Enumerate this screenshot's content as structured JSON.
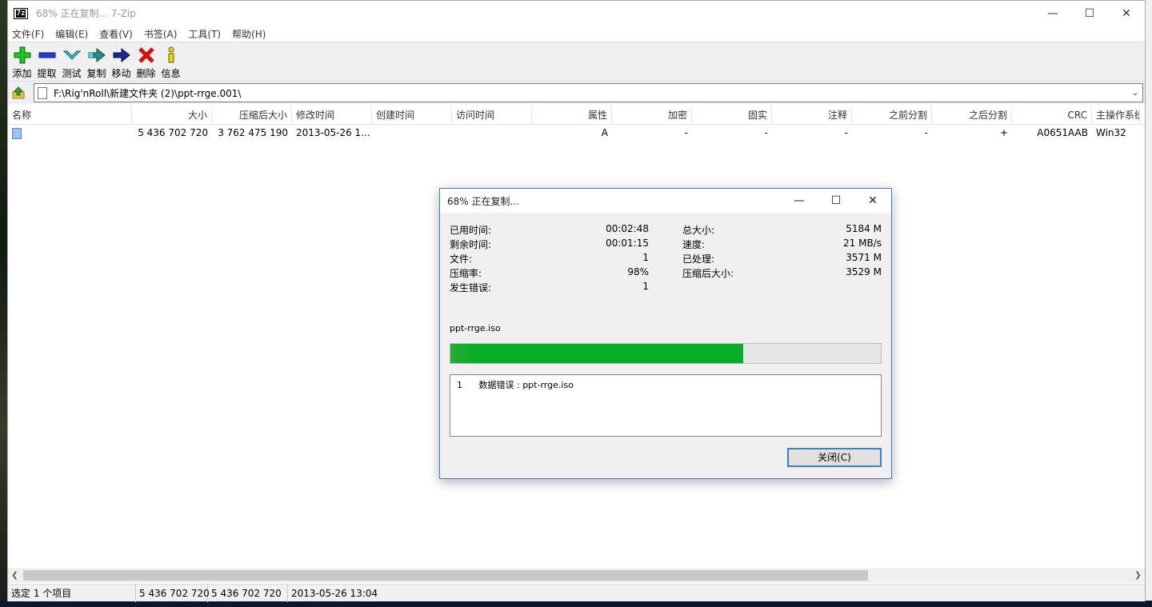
{
  "window": {
    "title": "68% 正在复制... 7-Zip",
    "icon_text": "7z",
    "controls": {
      "minimize": "—",
      "maximize": "☐",
      "close": "✕"
    }
  },
  "menu": [
    "文件(F)",
    "编辑(E)",
    "查看(V)",
    "书签(A)",
    "工具(T)",
    "帮助(H)"
  ],
  "toolbar": [
    {
      "label": "添加",
      "icon": "add-icon"
    },
    {
      "label": "提取",
      "icon": "extract-icon"
    },
    {
      "label": "测试",
      "icon": "test-icon"
    },
    {
      "label": "复制",
      "icon": "copy-icon"
    },
    {
      "label": "移动",
      "icon": "move-icon"
    },
    {
      "label": "删除",
      "icon": "delete-icon"
    },
    {
      "label": "信息",
      "icon": "info-icon"
    }
  ],
  "address": {
    "path": "F:\\Rig'nRoll\\新建文件夹 (2)\\ppt-rrge.001\\"
  },
  "columns": [
    "名称",
    "大小",
    "压缩后大小",
    "修改时间",
    "创建时间",
    "访问时间",
    "属性",
    "加密",
    "固实",
    "注释",
    "之前分割",
    "之后分割",
    "CRC",
    "主操作系统"
  ],
  "rows": [
    [
      "",
      "5 436 702 720",
      "3 762 475 190",
      "2013-05-26 1...",
      "",
      "",
      "A",
      "-",
      "-",
      "-",
      "-",
      "+",
      "A0651AAB",
      "Win32"
    ]
  ],
  "status": {
    "selected": "选定 1 个项目",
    "size": "5 436 702 720",
    "packed": "5 436 702 720",
    "modified": "2013-05-26 13:04"
  },
  "dialog": {
    "title": "68% 正在复制...",
    "stats": [
      {
        "l": "已用时间:",
        "v": "00:02:48",
        "l2": "总大小:",
        "v2": "5184 M"
      },
      {
        "l": "剩余时间:",
        "v": "00:01:15",
        "l2": "速度:",
        "v2": "21 MB/s"
      },
      {
        "l": "文件:",
        "v": "1",
        "l2": "已处理:",
        "v2": "3571 M"
      },
      {
        "l": "压缩率:",
        "v": "98%",
        "l2": "压缩后大小:",
        "v2": "3529 M"
      },
      {
        "l": "发生错误:",
        "v": "1",
        "l2": "",
        "v2": ""
      }
    ],
    "current_file": "ppt-rrge.iso",
    "progress_percent": 68,
    "error_num": "1",
    "error_text": "数据错误 : ppt-rrge.iso",
    "close_label": "关闭(C)"
  },
  "colors": {
    "progress": "#06b025",
    "dialog_border": "#3c7fc2"
  }
}
